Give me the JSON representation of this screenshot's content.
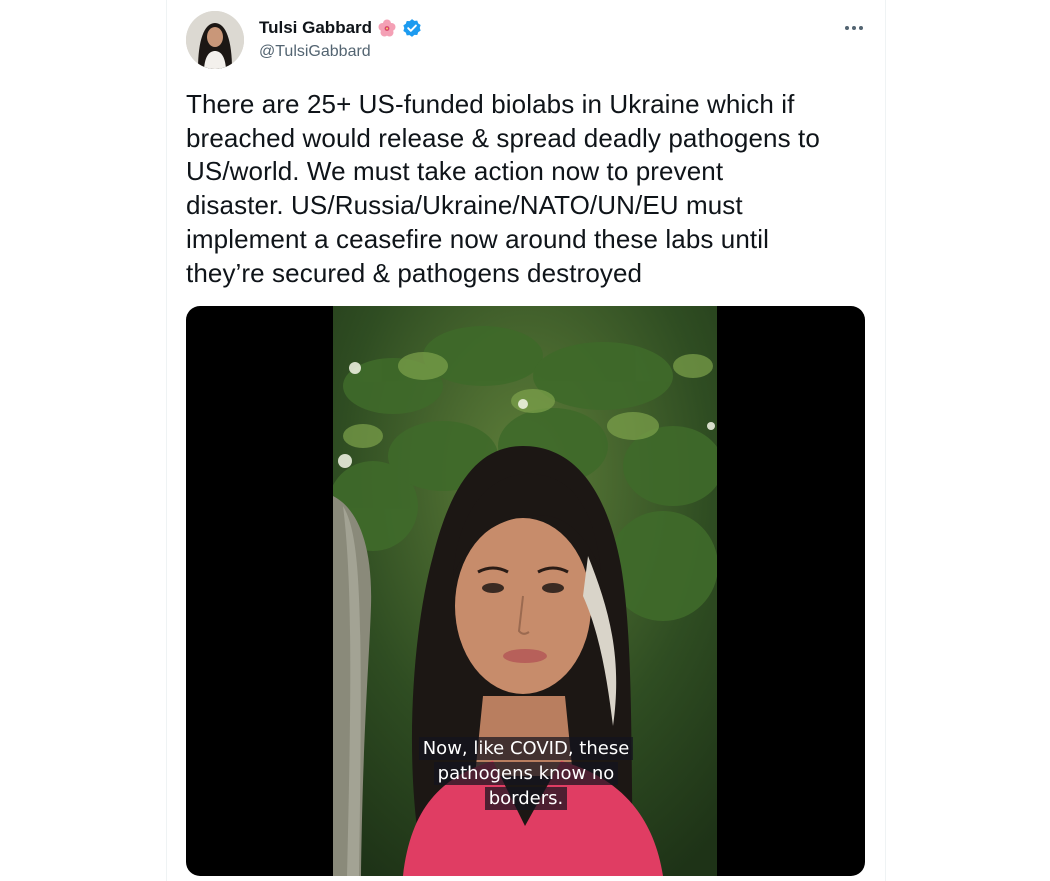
{
  "tweet": {
    "author": {
      "display_name": "Tulsi Gabbard",
      "handle": "@TulsiGabbard",
      "name_emoji_icon": "hibiscus-icon",
      "verified_icon": "verified-badge-icon"
    },
    "menu_icon": "more-options-icon",
    "text": "There are 25+ US-funded biolabs in Ukraine which if\nbreached would release & spread deadly pathogens to\nUS/world. We must take action now to prevent\ndisaster. US/Russia/Ukraine/NATO/UN/EU must\nimplement a ceasefire now around these labs until\nthey’re secured & pathogens destroyed",
    "media": {
      "type": "video",
      "caption_line1": "Now, like COVID, these",
      "caption_line2": "pathogens know no borders."
    }
  },
  "colors": {
    "text_primary": "#0f1419",
    "text_secondary": "#536471",
    "verified_blue": "#1d9bf0",
    "media_background": "#000000"
  }
}
